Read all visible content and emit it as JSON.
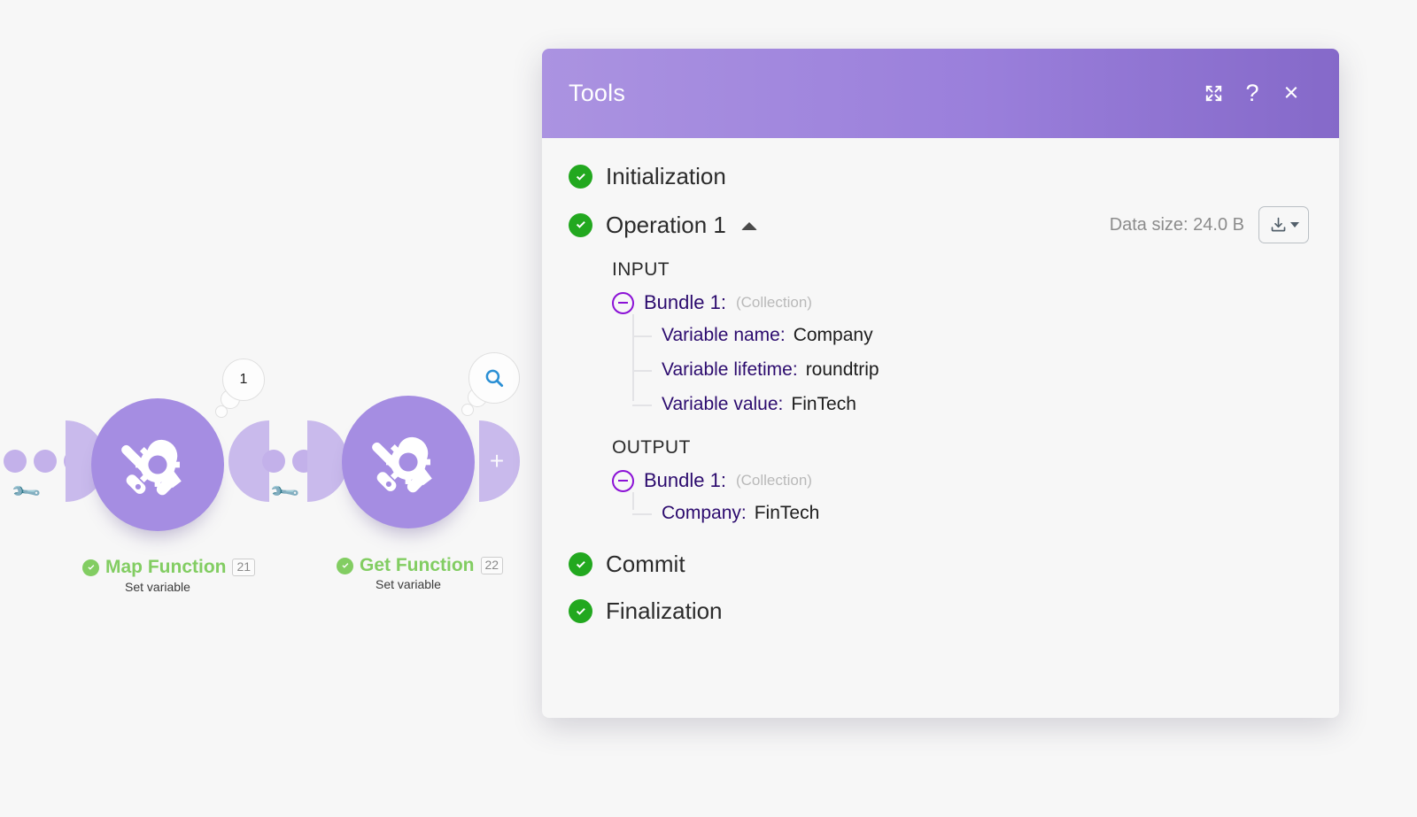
{
  "canvas": {
    "nodes": [
      {
        "id": "map-function",
        "label": "Map Function",
        "badge": "21",
        "subtitle": "Set variable",
        "icon": "tools-icon",
        "bubble_value": "1"
      },
      {
        "id": "get-function",
        "label": "Get Function",
        "badge": "22",
        "subtitle": "Set variable",
        "icon": "tools-icon",
        "bubble_icon": "magnifier-icon"
      }
    ],
    "add_module_label": "+",
    "colors": {
      "node_purple": "#a58de2",
      "connector_purple": "#c9baec",
      "label_green": "#82cd62",
      "magnifier_blue": "#2a8fd4"
    }
  },
  "panel": {
    "title": "Tools",
    "header_buttons": [
      {
        "name": "expand-icon",
        "label": ""
      },
      {
        "name": "help-icon",
        "label": "?"
      },
      {
        "name": "close-icon",
        "label": "×"
      }
    ],
    "stages": [
      {
        "name": "Initialization",
        "status": "success"
      },
      {
        "name": "Operation 1",
        "status": "success"
      },
      {
        "name": "Commit",
        "status": "success"
      },
      {
        "name": "Finalization",
        "status": "success"
      }
    ],
    "operation": {
      "data_size_label": "Data size: 24.0 B",
      "download_icon": "download-icon",
      "input": {
        "section_label": "INPUT",
        "bundle_label": "Bundle 1:",
        "bundle_type": "(Collection)",
        "rows": [
          {
            "key": "Variable name:",
            "value": "Company"
          },
          {
            "key": "Variable lifetime:",
            "value": "roundtrip"
          },
          {
            "key": "Variable value:",
            "value": "FinTech"
          }
        ]
      },
      "output": {
        "section_label": "OUTPUT",
        "bundle_label": "Bundle 1:",
        "bundle_type": "(Collection)",
        "rows": [
          {
            "key": "Company:",
            "value": "FinTech"
          }
        ]
      }
    },
    "colors": {
      "header_gradient_start": "#ab93e1",
      "header_gradient_end": "#8569c9",
      "success_green": "#22a81f",
      "key_purple": "#2c0b6e",
      "toggle_purple": "#8b11d6"
    }
  }
}
